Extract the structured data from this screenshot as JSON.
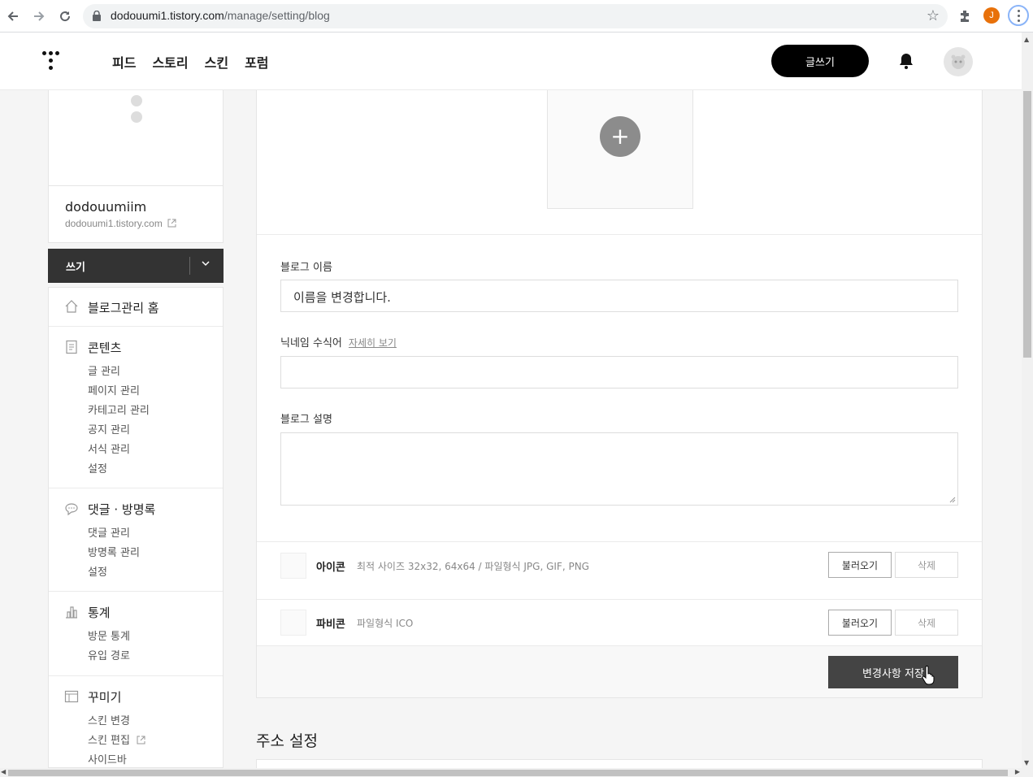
{
  "browser": {
    "url_host": "dodouumi1.tistory.com",
    "url_path": "/manage/setting/blog",
    "profile_initial": "J"
  },
  "header": {
    "nav": [
      "피드",
      "스토리",
      "스킨",
      "포럼"
    ],
    "write_label": "글쓰기"
  },
  "sidebar": {
    "blog_name": "dodouumiim",
    "blog_url": "dodouumi1.tistory.com",
    "write_label": "쓰기",
    "home_label": "블로그관리 홈",
    "groups": [
      {
        "title": "콘텐츠",
        "items": [
          "글 관리",
          "페이지 관리",
          "카테고리 관리",
          "공지 관리",
          "서식 관리",
          "설정"
        ]
      },
      {
        "title": "댓글 · 방명록",
        "items": [
          "댓글 관리",
          "방명록 관리",
          "설정"
        ]
      },
      {
        "title": "통계",
        "items": [
          "방문 통계",
          "유입 경로"
        ]
      },
      {
        "title": "꾸미기",
        "items": [
          "스킨 변경",
          "스킨 편집",
          "사이드바"
        ]
      }
    ]
  },
  "form": {
    "blog_name_label": "블로그 이름",
    "blog_name_value": "이름을 변경합니다.",
    "nickname_label": "닉네임 수식어",
    "nickname_link": "자세히 보기",
    "nickname_value": "",
    "description_label": "블로그 설명",
    "description_value": "",
    "icon_label": "아이콘",
    "icon_desc": "최적 사이즈 32x32, 64x64 / 파일형식 JPG, GIF, PNG",
    "favicon_label": "파비콘",
    "favicon_desc": "파일형식 ICO",
    "load_label": "불러오기",
    "delete_label": "삭제",
    "save_label": "변경사항 저장"
  },
  "address_section_title": "주소 설정",
  "colors": {
    "dark_button": "#444444",
    "black_button": "#000000",
    "write_bar": "#333333"
  }
}
